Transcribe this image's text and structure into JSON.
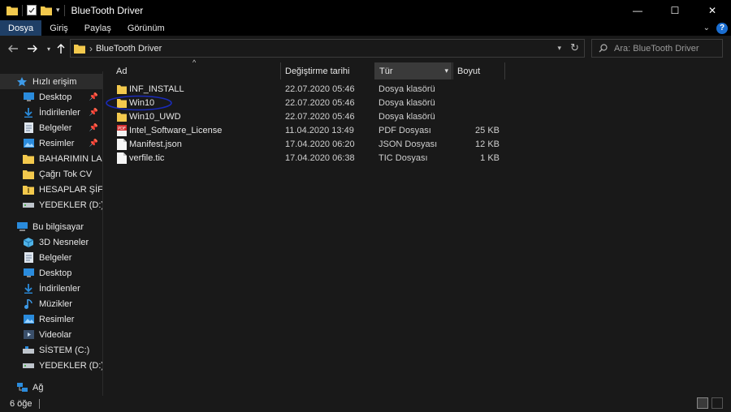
{
  "window": {
    "title": "BlueTooth Driver",
    "controls": {
      "minimize": "—",
      "maximize": "☐",
      "close": "✕"
    }
  },
  "ribbon": {
    "tabs": [
      {
        "label": "Dosya",
        "active": true
      },
      {
        "label": "Giriş",
        "active": false
      },
      {
        "label": "Paylaş",
        "active": false
      },
      {
        "label": "Görünüm",
        "active": false
      }
    ],
    "help": "?"
  },
  "address": {
    "path": "BlueTooth Driver",
    "separator": "›"
  },
  "search": {
    "placeholder": "Ara: BlueTooth Driver"
  },
  "nav": {
    "items": [
      {
        "label": "Hızlı erişim",
        "icon": "star-icon",
        "selected": true
      },
      {
        "label": "Desktop",
        "icon": "desktop-icon",
        "pinned": true
      },
      {
        "label": "İndirilenler",
        "icon": "download-icon",
        "pinned": true
      },
      {
        "label": "Belgeler",
        "icon": "documents-icon",
        "pinned": true
      },
      {
        "label": "Resimler",
        "icon": "pictures-icon",
        "pinned": true
      },
      {
        "label": "BAHARIMIN LAPTO",
        "icon": "folder-icon"
      },
      {
        "label": "Çağrı Tok CV",
        "icon": "folder-icon"
      },
      {
        "label": "HESAPLAR ŞİFRELER",
        "icon": "zip-folder-icon"
      },
      {
        "label": "YEDEKLER (D:)",
        "icon": "drive-icon"
      },
      {
        "label": "Bu bilgisayar",
        "icon": "computer-icon"
      },
      {
        "label": "3D Nesneler",
        "icon": "3d-objects-icon"
      },
      {
        "label": "Belgeler",
        "icon": "documents-icon"
      },
      {
        "label": "Desktop",
        "icon": "desktop-icon"
      },
      {
        "label": "İndirilenler",
        "icon": "download-icon"
      },
      {
        "label": "Müzikler",
        "icon": "music-icon"
      },
      {
        "label": "Resimler",
        "icon": "pictures-icon"
      },
      {
        "label": "Videolar",
        "icon": "videos-icon"
      },
      {
        "label": "SİSTEM (C:)",
        "icon": "drive-icon"
      },
      {
        "label": "YEDEKLER (D:)",
        "icon": "drive-icon"
      },
      {
        "label": "Ağ",
        "icon": "network-icon"
      }
    ]
  },
  "columns": {
    "name": "Ad",
    "date": "Değiştirme tarihi",
    "type": "Tür",
    "size": "Boyut"
  },
  "files": [
    {
      "name": "INF_INSTALL",
      "date": "22.07.2020 05:46",
      "type": "Dosya klasörü",
      "size": "",
      "icon": "folder-icon"
    },
    {
      "name": "Win10",
      "date": "22.07.2020 05:46",
      "type": "Dosya klasörü",
      "size": "",
      "icon": "folder-icon"
    },
    {
      "name": "Win10_UWD",
      "date": "22.07.2020 05:46",
      "type": "Dosya klasörü",
      "size": "",
      "icon": "folder-icon"
    },
    {
      "name": "Intel_Software_License",
      "date": "11.04.2020 13:49",
      "type": "PDF Dosyası",
      "size": "25 KB",
      "icon": "pdf-icon"
    },
    {
      "name": "Manifest.json",
      "date": "17.04.2020 06:20",
      "type": "JSON Dosyası",
      "size": "12 KB",
      "icon": "file-icon"
    },
    {
      "name": "verfile.tic",
      "date": "17.04.2020 06:38",
      "type": "TIC Dosyası",
      "size": "1 KB",
      "icon": "file-icon"
    }
  ],
  "status": {
    "count": "6 öğe"
  },
  "colors": {
    "folder": "#f3c94d",
    "accent": "#1f3f66",
    "highlight_circle": "#1a2bb8"
  }
}
